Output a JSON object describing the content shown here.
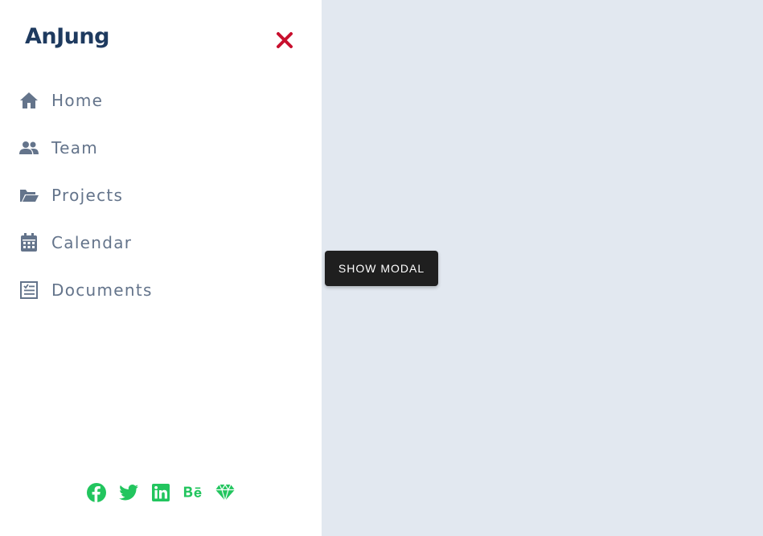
{
  "brand": {
    "logo_text": "AnJung"
  },
  "colors": {
    "sidebar_bg": "#ffffff",
    "main_bg": "#e2e8f0",
    "close": "#c8102e",
    "nav_text": "#64748b",
    "social_accent": "#22c55e",
    "button_bg": "#1f1f1f"
  },
  "sidebar": {
    "close_icon": "close-icon",
    "items": [
      {
        "label": "Home",
        "icon": "home-icon"
      },
      {
        "label": "Team",
        "icon": "users-icon"
      },
      {
        "label": "Projects",
        "icon": "folder-open-icon"
      },
      {
        "label": "Calendar",
        "icon": "calendar-icon"
      },
      {
        "label": "Documents",
        "icon": "document-icon"
      }
    ],
    "socials": [
      "facebook-icon",
      "twitter-icon",
      "linkedin-icon",
      "behance-icon",
      "sketch-icon"
    ]
  },
  "main": {
    "show_modal_label": "SHOW MODAL"
  }
}
